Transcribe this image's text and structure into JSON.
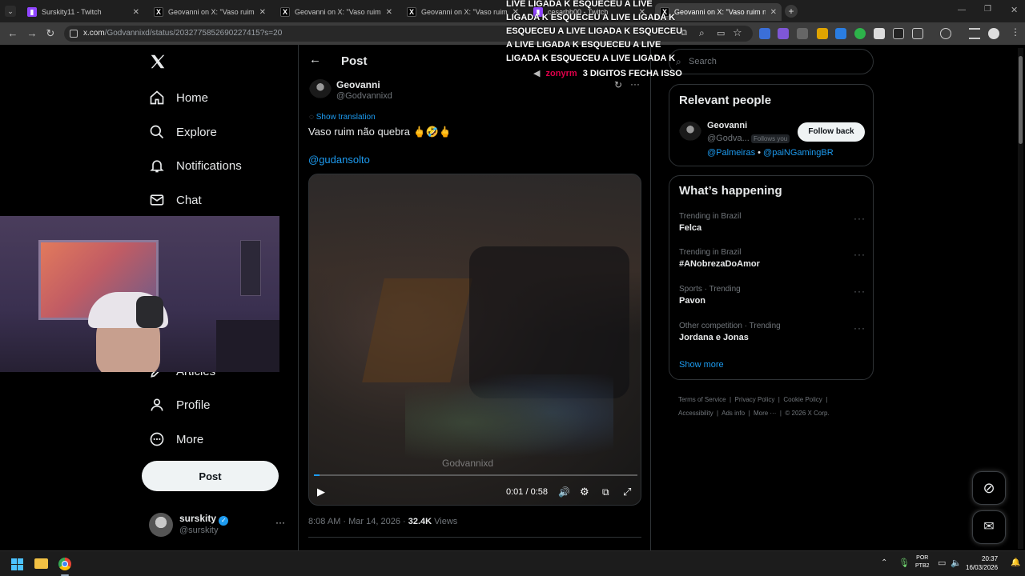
{
  "browser": {
    "tabs": [
      {
        "title": "Surskity11 - Twitch",
        "icon": "twitch-icon"
      },
      {
        "title": "Geovanni on X: \"Vaso ruim não",
        "icon": "x-logo-icon"
      },
      {
        "title": "Geovanni on X: \"Vaso ruim não",
        "icon": "x-logo-icon"
      },
      {
        "title": "Geovanni on X: \"Vaso ruim não",
        "icon": "x-logo-icon"
      },
      {
        "title": "cesarbb00 - Twitch",
        "icon": "twitch-icon"
      },
      {
        "title": "Geovanni on X: \"Vaso ruim não",
        "icon": "x-logo-icon"
      }
    ],
    "url_domain": "x.com",
    "url_path": "/Godvannixd/status/2032775852690227415?s=20"
  },
  "overlay": {
    "scroll_text": "LIVE LIGADA K ESQUECEU A LIVE LIGADA K ESQUECEU A LIVE LIGADA K ESQUECEU A LIVE LIGADA K ESQUECEU A LIVE LIGADA K ESQUECEU A LIVE LIGADA K ESQUECEU A LIVE LIGADA K",
    "chat_user": "zonyrm",
    "chat_msg": "3 DIGITOS FECHA ISSO"
  },
  "sidebar": {
    "items": [
      {
        "label": "Home",
        "icon": "home-icon"
      },
      {
        "label": "Explore",
        "icon": "search-icon"
      },
      {
        "label": "Notifications",
        "icon": "bell-icon"
      },
      {
        "label": "Chat",
        "icon": "mail-icon"
      },
      {
        "label": "Articles",
        "icon": "article-icon"
      },
      {
        "label": "Profile",
        "icon": "person-icon"
      },
      {
        "label": "More",
        "icon": "more-circle-icon"
      }
    ],
    "post_label": "Post",
    "account": {
      "name": "surskity",
      "handle": "@surskity"
    }
  },
  "post": {
    "header_title": "Post",
    "author_name": "Geovanni",
    "author_handle": "@Godvannixd",
    "show_translation": "Show translation",
    "text": "Vaso ruim não quebra 🖕🤣🖕",
    "mention": "@gudansolto",
    "video": {
      "watermark": "Godvannixd",
      "time": "0:01 / 0:58",
      "progress": 0.017
    },
    "timestamp": "8:08 AM · Mar 14, 2026 · ",
    "views_count": "32.4K",
    "views_label": "Views"
  },
  "right": {
    "search_placeholder": "Search",
    "relevant_title": "Relevant people",
    "person": {
      "name": "Geovanni",
      "handle": "@Godva...",
      "follows_you": "Follows you",
      "follow_back": "Follow back",
      "bio_link1": "@Palmeiras",
      "bio_sep": " • ",
      "bio_link2": "@paiNGamingBR"
    },
    "happening_title": "What’s happening",
    "trends": [
      {
        "meta": "Trending in Brazil",
        "title": "Felca"
      },
      {
        "meta": "Trending in Brazil",
        "title": "#ANobrezaDoAmor"
      },
      {
        "meta": "Sports · Trending",
        "title": "Pavon"
      },
      {
        "meta": "Other competition · Trending",
        "title": "Jordana e Jonas"
      }
    ],
    "show_more": "Show more",
    "footer_row1": [
      "Terms of Service",
      "Privacy Policy",
      "Cookie Policy"
    ],
    "footer_row2": [
      "Accessibility",
      "Ads info",
      "More ···",
      "© 2026 X Corp."
    ]
  },
  "taskbar": {
    "lang": "POR",
    "lang_sub": "PTB2",
    "time": "20:37",
    "date": "16/03/2026"
  }
}
